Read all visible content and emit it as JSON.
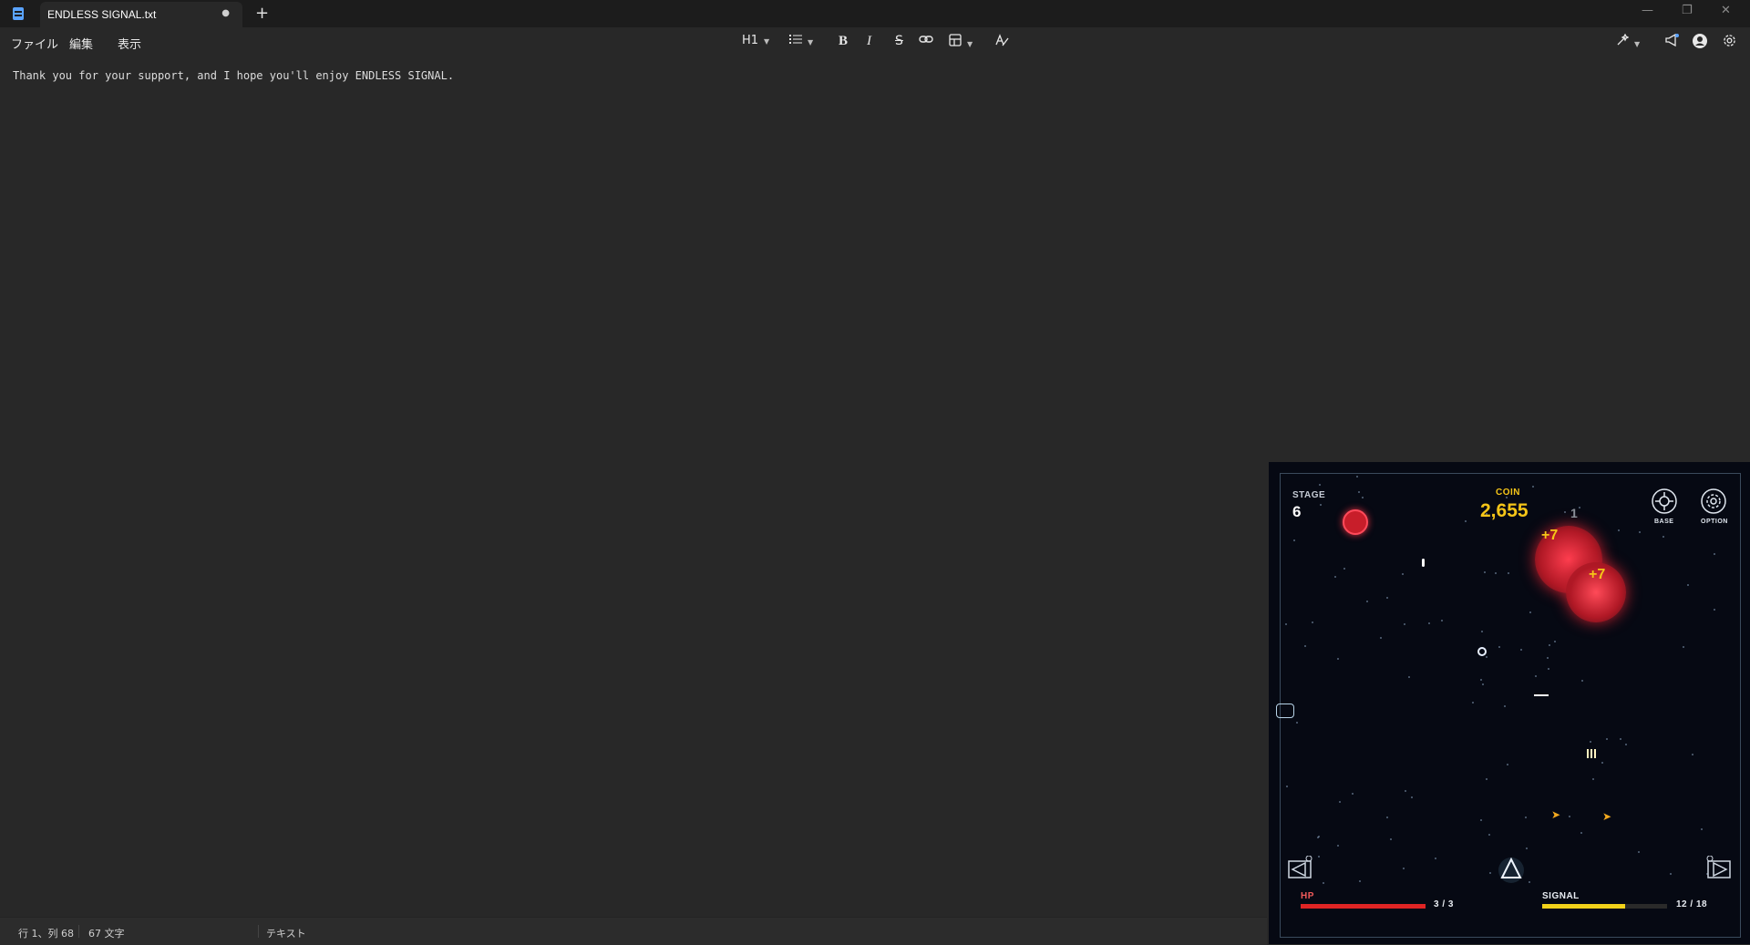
{
  "tab": {
    "title": "ENDLESS SIGNAL.txt",
    "unsaved_marker": "●",
    "add": "+"
  },
  "menu": {
    "file": "ファイル",
    "edit": "編集",
    "view": "表示"
  },
  "toolbar": {
    "heading": "H1",
    "bold": "B",
    "italic": "I",
    "strike": "S"
  },
  "document": {
    "text": "Thank you for your support, and I hope you'll enjoy ENDLESS SIGNAL."
  },
  "status": {
    "position": "行 1、列 68",
    "chars": "67 文字",
    "format": "テキスト"
  },
  "game": {
    "stage_label": "STAGE",
    "stage_value": "6",
    "coin_label": "COIN",
    "coin_value": "2,655",
    "base_label": "BASE",
    "option_label": "OPTION",
    "hp_label": "HP",
    "hp_value": "3 / 3",
    "hp_fill": 1.0,
    "signal_label": "SIGNAL",
    "signal_value": "12 / 18",
    "signal_fill": 0.667,
    "popup_1": "+7",
    "popup_2": "+7",
    "enemy_count": "1",
    "colors": {
      "coin": "#f5c518",
      "hp": "#e02424",
      "signal": "#f2d21a",
      "enemy": "#c81e2a"
    }
  }
}
